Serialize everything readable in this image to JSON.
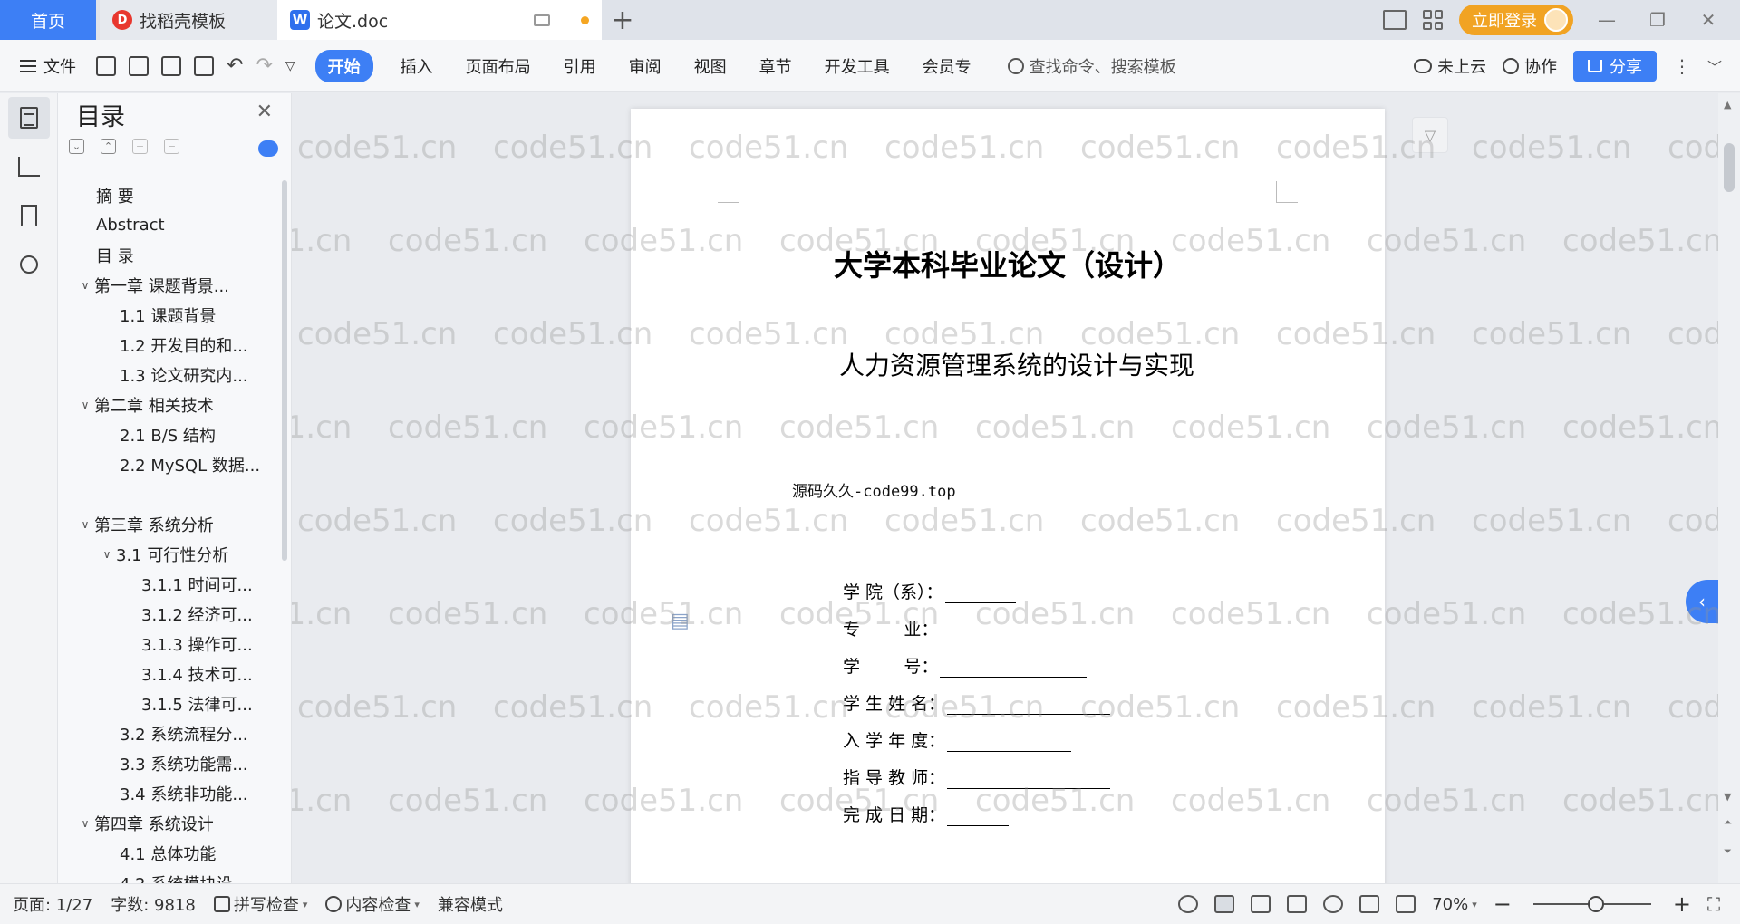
{
  "titlebar": {
    "home_tab": "首页",
    "template_tab": "找稻壳模板",
    "doc_tab": "论文.doc",
    "login_label": "立即登录"
  },
  "ribbon": {
    "file_label": "文件",
    "tabs": [
      "开始",
      "插入",
      "页面布局",
      "引用",
      "审阅",
      "视图",
      "章节",
      "开发工具",
      "会员专"
    ],
    "active_tab": "开始",
    "search_placeholder": "查找命令、搜索模板",
    "cloud_label": "未上云",
    "collab_label": "协作",
    "share_label": "分享"
  },
  "toc": {
    "title": "目录",
    "items": [
      {
        "text": "摘    要",
        "level": 1,
        "arrow": ""
      },
      {
        "text": "Abstract",
        "level": 1,
        "arrow": ""
      },
      {
        "text": "目    录",
        "level": 1,
        "arrow": ""
      },
      {
        "text": "第一章   课题背景...",
        "level": 1,
        "arrow": "v"
      },
      {
        "text": "1.1  课题背景",
        "level": 2,
        "arrow": ""
      },
      {
        "text": "1.2  开发目的和...",
        "level": 2,
        "arrow": ""
      },
      {
        "text": "1.3  论文研究内...",
        "level": 2,
        "arrow": ""
      },
      {
        "text": "第二章  相关技术",
        "level": 1,
        "arrow": "v"
      },
      {
        "text": "2.1 B/S 结构",
        "level": 2,
        "arrow": ""
      },
      {
        "text": "2.2 MySQL 数据...",
        "level": 2,
        "arrow": ""
      },
      {
        "text": "",
        "level": 0,
        "arrow": ""
      },
      {
        "text": "第三章  系统分析",
        "level": 1,
        "arrow": "v"
      },
      {
        "text": "3.1 可行性分析",
        "level": 2,
        "arrow": "v"
      },
      {
        "text": "3.1.1 时间可...",
        "level": 3,
        "arrow": ""
      },
      {
        "text": "3.1.2  经济可...",
        "level": 3,
        "arrow": ""
      },
      {
        "text": "3.1.3  操作可...",
        "level": 3,
        "arrow": ""
      },
      {
        "text": "3.1.4  技术可...",
        "level": 3,
        "arrow": ""
      },
      {
        "text": "3.1.5  法律可...",
        "level": 3,
        "arrow": ""
      },
      {
        "text": "3.2 系统流程分...",
        "level": 2,
        "arrow": ""
      },
      {
        "text": "3.3 系统功能需...",
        "level": 2,
        "arrow": ""
      },
      {
        "text": "3.4  系统非功能...",
        "level": 2,
        "arrow": ""
      },
      {
        "text": "第四章  系统设计",
        "level": 1,
        "arrow": "v"
      },
      {
        "text": "4.1  总体功能",
        "level": 2,
        "arrow": ""
      },
      {
        "text": "4.2  系统模块设...",
        "level": 2,
        "arrow": ""
      }
    ]
  },
  "document": {
    "title": "大学本科毕业论文（设计）",
    "subtitle": "人力资源管理系统的设计与实现",
    "source_line": "源码久久-code99.top",
    "fields": [
      {
        "label": "学 院（系）：",
        "line": 78
      },
      {
        "label": "专        业：",
        "line": 86
      },
      {
        "label": "学        号：",
        "line": 162
      },
      {
        "label": "学 生 姓 名：",
        "line": 180
      },
      {
        "label": "入 学 年 度：",
        "line": 137
      },
      {
        "label": "指 导 教 师：",
        "line": 180
      },
      {
        "label": "完 成 日 期：",
        "line": 68
      }
    ]
  },
  "watermark": "code51.cn",
  "statusbar": {
    "page": "页面: 1/27",
    "words": "字数: 9818",
    "spell": "拼写检查",
    "content_check": "内容检查",
    "compat": "兼容模式",
    "zoom": "70%"
  },
  "colors": {
    "accent": "#3d7ff5",
    "login": "#f1a323"
  }
}
